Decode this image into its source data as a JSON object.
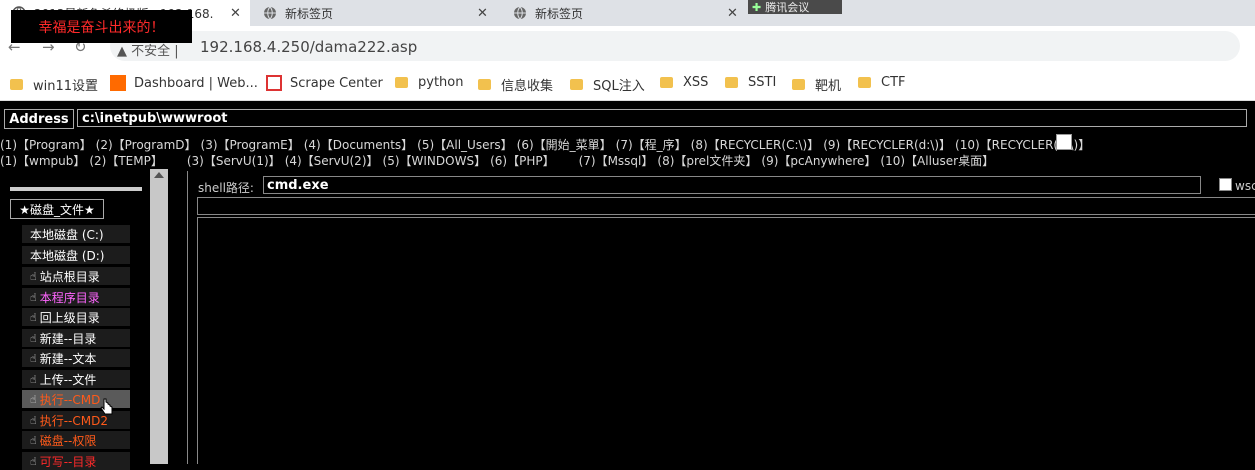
{
  "browser": {
    "tabs": [
      {
        "label": "2013最新免杀终极版...192.168.",
        "active": true
      },
      {
        "label": "新标签页",
        "active": false
      },
      {
        "label": "新标签页",
        "active": false
      }
    ],
    "overlay_notice": "幸福是奋斗出来的！",
    "overlay_meeting": "腾讯会议",
    "security_label": "不安全",
    "url": "192.168.4.250/dama222.asp",
    "bookmarks": [
      "win11设置",
      "Dashboard | Web...",
      "Scrape Center",
      "python",
      "信息收集",
      "SQL注入",
      "XSS",
      "SSTI",
      "靶机",
      "CTF"
    ]
  },
  "shell": {
    "address_label": "Address",
    "address_value": "c:\\inetpub\\wwwroot",
    "path_links_row1": [
      "(1)【Program】",
      "(2)【ProgramD】",
      "(3)【ProgramE】",
      "(4)【Documents】",
      "(5)【All_Users】",
      "(6)【開始_菜單】",
      "(7)【程_序】",
      "(8)【RECYCLER(C:\\)】",
      "(9)【RECYCLER(d:\\)】",
      "(10)【RECYCLER(e:\\)】"
    ],
    "path_links_row2": [
      "(1)【wmpub】",
      "(2)【TEMP】",
      "(3)【ServU(1)】",
      "(4)【ServU(2)】",
      "(5)【WINDOWS】",
      "(6)【PHP】",
      "(7)【Mssql】",
      "(8)【prel文件夹】",
      "(9)【pcAnywhere】",
      "(10)【Alluser桌面】"
    ],
    "sidebar_title": "★磁盘_文件★",
    "menu": [
      {
        "label": "本地磁盘 (C:)",
        "icon": false,
        "color": "#ffffff"
      },
      {
        "label": "本地磁盘 (D:)",
        "icon": false,
        "color": "#ffffff"
      },
      {
        "label": "站点根目录",
        "icon": true,
        "color": "#ffffff"
      },
      {
        "label": "本程序目录",
        "icon": true,
        "color": "#ff66ff"
      },
      {
        "label": "回上级目录",
        "icon": true,
        "color": "#ffffff"
      },
      {
        "label": "新建--目录",
        "icon": true,
        "color": "#ffffff"
      },
      {
        "label": "新建--文本",
        "icon": true,
        "color": "#ffffff"
      },
      {
        "label": "上传--文件",
        "icon": true,
        "color": "#ffffff"
      },
      {
        "label": "执行--CMD",
        "icon": true,
        "color": "#ff5a1a",
        "selected": true
      },
      {
        "label": "执行--CMD2",
        "icon": true,
        "color": "#ff5a1a"
      },
      {
        "label": "磁盘--权限",
        "icon": true,
        "color": "#ff5a1a"
      },
      {
        "label": "可写--目录",
        "icon": true,
        "color": "#ff2a2a"
      }
    ],
    "shell_path_label": "shell路径:",
    "shell_path_value": "cmd.exe",
    "wscript_label": "wsc"
  },
  "colors": {
    "accent_red": "#ff2a2a",
    "accent_orange": "#ff5a1a",
    "accent_pink": "#ff66ff"
  }
}
